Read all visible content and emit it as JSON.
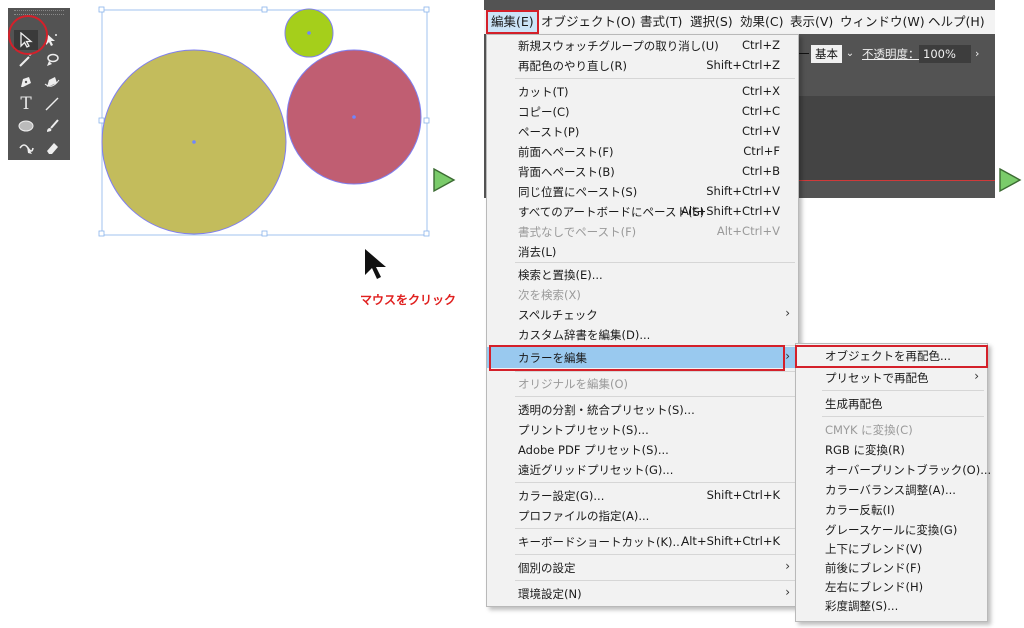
{
  "toolbar": {
    "tools": [
      {
        "icon": "selection-tool-icon"
      },
      {
        "icon": "direct-selection-tool-icon"
      },
      {
        "icon": "magic-wand-tool-icon"
      },
      {
        "icon": "lasso-tool-icon"
      },
      {
        "icon": "pen-tool-icon"
      },
      {
        "icon": "curvature-tool-icon"
      },
      {
        "icon": "type-tool-icon"
      },
      {
        "icon": "line-tool-icon"
      },
      {
        "icon": "ellipse-tool-icon"
      },
      {
        "icon": "paintbrush-tool-icon"
      },
      {
        "icon": "shaper-tool-icon"
      },
      {
        "icon": "eraser-tool-icon"
      }
    ]
  },
  "canvas": {
    "circle_colors": {
      "yellow": "#c3bc5c",
      "red": "#c05e72",
      "green": "#a5cf1b"
    },
    "selection_color": "#7f7ff0"
  },
  "colors": {
    "accent": "#d4202a",
    "arrow": "#7acb6a",
    "highlight": "#99c9ef"
  },
  "cursor_label": "マウスをクリック",
  "menubar": [
    "編集(E)",
    "オブジェクト(O)",
    "書式(T)",
    "選択(S)",
    "効果(C)",
    "表示(V)",
    "ウィンドウ(W)",
    "ヘルプ(H)"
  ],
  "controlbar": {
    "style_label": "基本",
    "opacity_label": "不透明度：",
    "opacity_value": "100%"
  },
  "edit_menu": [
    {
      "label": "新規スウォッチグループの取り消し(U)",
      "shortcut": "Ctrl+Z"
    },
    {
      "label": "再配色のやり直し(R)",
      "shortcut": "Shift+Ctrl+Z"
    },
    {
      "label": "カット(T)",
      "shortcut": "Ctrl+X"
    },
    {
      "label": "コピー(C)",
      "shortcut": "Ctrl+C"
    },
    {
      "label": "ペースト(P)",
      "shortcut": "Ctrl+V"
    },
    {
      "label": "前面へペースト(F)",
      "shortcut": "Ctrl+F"
    },
    {
      "label": "背面へペースト(B)",
      "shortcut": "Ctrl+B"
    },
    {
      "label": "同じ位置にペースト(S)",
      "shortcut": "Shift+Ctrl+V"
    },
    {
      "label": "すべてのアートボードにペースト(S)",
      "shortcut": "Alt+Shift+Ctrl+V"
    },
    {
      "label": "書式なしでペースト(F)",
      "shortcut": "Alt+Ctrl+V"
    },
    {
      "label": "消去(L)",
      "shortcut": ""
    },
    {
      "label": "検索と置換(E)...",
      "shortcut": ""
    },
    {
      "label": "次を検索(X)",
      "shortcut": ""
    },
    {
      "label": "スペルチェック",
      "shortcut": ""
    },
    {
      "label": "カスタム辞書を編集(D)...",
      "shortcut": ""
    },
    {
      "label": "カラーを編集",
      "shortcut": ""
    },
    {
      "label": "オリジナルを編集(O)",
      "shortcut": ""
    },
    {
      "label": "透明の分割・統合プリセット(S)...",
      "shortcut": ""
    },
    {
      "label": "プリントプリセット(S)...",
      "shortcut": ""
    },
    {
      "label": "Adobe PDF プリセット(S)...",
      "shortcut": ""
    },
    {
      "label": "遠近グリッドプリセット(G)...",
      "shortcut": ""
    },
    {
      "label": "カラー設定(G)...",
      "shortcut": "Shift+Ctrl+K"
    },
    {
      "label": "プロファイルの指定(A)...",
      "shortcut": ""
    },
    {
      "label": "キーボードショートカット(K)...",
      "shortcut": "Alt+Shift+Ctrl+K"
    },
    {
      "label": "個別の設定",
      "shortcut": ""
    },
    {
      "label": "環境設定(N)",
      "shortcut": ""
    }
  ],
  "color_submenu": [
    {
      "label": "オブジェクトを再配色..."
    },
    {
      "label": "プリセットで再配色"
    },
    {
      "label": "生成再配色"
    },
    {
      "label": "CMYK に変換(C)"
    },
    {
      "label": "RGB に変換(R)"
    },
    {
      "label": "オーバープリントブラック(O)..."
    },
    {
      "label": "カラーバランス調整(A)..."
    },
    {
      "label": "カラー反転(I)"
    },
    {
      "label": "グレースケールに変換(G)"
    },
    {
      "label": "上下にブレンド(V)"
    },
    {
      "label": "前後にブレンド(F)"
    },
    {
      "label": "左右にブレンド(H)"
    },
    {
      "label": "彩度調整(S)..."
    }
  ]
}
